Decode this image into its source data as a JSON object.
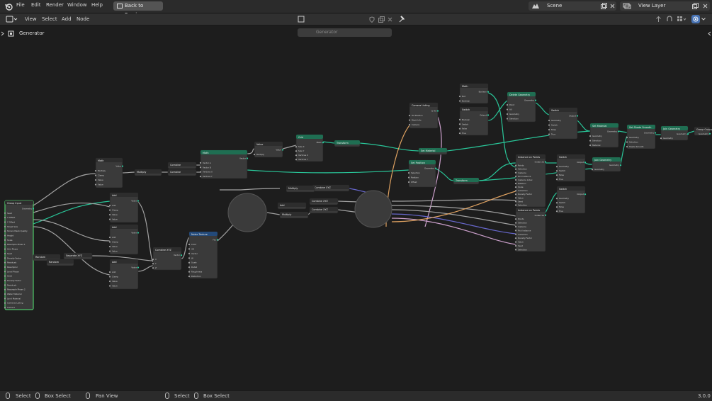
{
  "menu": [
    "File",
    "Edit",
    "Render",
    "Window",
    "Help"
  ],
  "back_button": "Back to Previous",
  "scene": "Scene",
  "view_layer": "View Layer",
  "editor_menu": [
    "View",
    "Select",
    "Add",
    "Node"
  ],
  "node_tree_name": "Generator",
  "breadcrumb": "Generator",
  "status": {
    "items": [
      "Select",
      "Box Select",
      "Pan View",
      "Select",
      "Box Select"
    ],
    "version": "3.0.0"
  },
  "colors": {
    "background": "#1d1d1d",
    "node_body": "#3a3a3a",
    "geometry_header": "#1f6e52",
    "input_header": "#2d2d2d",
    "vector_header": "#234a7a",
    "geometry_link": "#2ad0a0",
    "float_link": "#aaaaaa",
    "vector_link": "#6b6bd6",
    "bool_link": "#d6a8d6",
    "int_link": "#e8a864",
    "selected_outline": "#4fc86a"
  },
  "nodes": [
    {
      "title": "Group Input",
      "rows": [
        "Geometry",
        "Seed",
        "X Offset",
        "Y Offset",
        "Street Size",
        "Terrain Mesh Quality",
        "Height",
        "Scale",
        "Resample Phase 1",
        "Grid Phase",
        "Seed",
        "Density Factor",
        "Residuals",
        "Resampler",
        "Level Phase",
        "Seed",
        "Density Factor",
        "Residuals",
        "Resample Phase 2",
        "Water Material",
        "Land Material",
        "Cameras Listing",
        "Camera"
      ]
    },
    {
      "title": "Math",
      "rows": [
        "Value",
        "Multiply",
        "Clamp",
        "Value",
        "Value"
      ]
    },
    {
      "title": "Multiply",
      "rows": []
    },
    {
      "title": "Combine",
      "rows": []
    },
    {
      "title": "Combine",
      "rows": []
    },
    {
      "title": "Math",
      "rows": [
        "Vector",
        "Vector A",
        "Vector B",
        "Vertices X",
        "Vertices Y"
      ]
    },
    {
      "title": "Value",
      "rows": [
        "Value",
        "Multiply"
      ]
    },
    {
      "title": "Grid",
      "rows": [
        "Mesh",
        "Size X",
        "Size Y",
        "Vertices X",
        "Vertices Y"
      ]
    },
    {
      "title": "Transform",
      "rows": []
    },
    {
      "title": "Add",
      "rows": [
        "Value",
        "Add",
        "Clamp",
        "Value",
        "Value"
      ]
    },
    {
      "title": "Add",
      "rows": [
        "Value",
        "Add",
        "Clamp",
        "Value",
        "Value"
      ]
    },
    {
      "title": "Add",
      "rows": [
        "Value",
        "Add",
        "Clamp",
        "Value",
        "Value"
      ]
    },
    {
      "title": "Random",
      "rows": []
    },
    {
      "title": "Random",
      "rows": []
    },
    {
      "title": "Separate XYZ",
      "rows": []
    },
    {
      "title": "Combine XYZ",
      "rows": [
        "Vector",
        "X",
        "Y",
        "Z"
      ]
    },
    {
      "title": "Noise Texture",
      "rows": [
        "Fac",
        "Color",
        "3D",
        "Vector",
        "W",
        "Scale",
        "Detail",
        "Roughness",
        "Distortion"
      ]
    },
    {
      "title": "Set Position",
      "rows": [
        "Geometry",
        "Selection",
        "Position",
        "Offset"
      ]
    },
    {
      "title": "Combine XYZ",
      "rows": []
    },
    {
      "title": "Combine XYZ",
      "rows": []
    },
    {
      "title": "Combine XYZ",
      "rows": []
    },
    {
      "title": "Multiply",
      "rows": []
    },
    {
      "title": "Multiply",
      "rows": []
    },
    {
      "title": "Add",
      "rows": []
    },
    {
      "title": "Set Material",
      "rows": []
    },
    {
      "title": "Transform",
      "rows": []
    },
    {
      "title": "Camera Listing",
      "rows": [
        "Is Hit",
        "Hit Position",
        "Mesh Info",
        "Camera"
      ]
    },
    {
      "title": "Math",
      "rows": [
        "Boolean",
        "Not",
        "Boolean"
      ]
    },
    {
      "title": "Switch",
      "rows": [
        "Output",
        "Boolean",
        "Switch",
        "False",
        "True"
      ]
    },
    {
      "title": "Delete Geometry",
      "rows": [
        "Geometry",
        "Point",
        "All",
        "Geometry",
        "Selection"
      ]
    },
    {
      "title": "Switch",
      "rows": [
        "Output",
        "Geometry",
        "Switch",
        "False",
        "True"
      ]
    },
    {
      "title": "Set Material",
      "rows": [
        "Geometry",
        "Geometry",
        "Selection",
        "Material"
      ]
    },
    {
      "title": "Set Shade Smooth",
      "rows": [
        "Geometry",
        "Geometry",
        "Selection",
        "Shade Smooth"
      ]
    },
    {
      "title": "Join Geometry",
      "rows": [
        "Geometry",
        "Geometry"
      ]
    },
    {
      "title": "Group Output",
      "rows": [
        "Geometry"
      ]
    },
    {
      "title": "Instance on Points",
      "rows": [
        "Instances",
        "Points",
        "Selection",
        "Instance",
        "Pick Instance",
        "Instance Index",
        "Rotation",
        "Scale",
        "Collection",
        "Density Factor",
        "Value",
        "Seed",
        "Selection"
      ]
    },
    {
      "title": "Switch",
      "rows": [
        "Output",
        "Geometry",
        "Switch",
        "False",
        "True"
      ]
    },
    {
      "title": "Join Geometry",
      "rows": [
        "Geometry",
        "Geometry"
      ]
    },
    {
      "title": "Switch",
      "rows": [
        "Output",
        "Geometry",
        "Switch",
        "False",
        "True"
      ]
    },
    {
      "title": "Instance on Points",
      "rows": [
        "Instances",
        "Points",
        "Selection",
        "Instance",
        "Pick Instance",
        "Collection",
        "Density Factor",
        "Value",
        "Seed",
        "Selection"
      ]
    }
  ]
}
